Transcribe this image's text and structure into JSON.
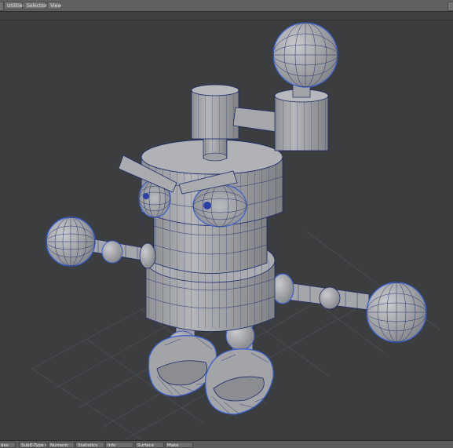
{
  "app": {
    "menu_tabs": [
      "Utilities",
      "Selection",
      "View"
    ]
  },
  "statusbar": {
    "sides_label": "des",
    "subd_label": "SubD-Type",
    "numeric_label": "Numeric",
    "statistics_label": "Statistics",
    "info_label": "Info",
    "surface_label": "Surface",
    "make_label": "Make"
  },
  "icons": {
    "dropdown": "chevron-down-icon"
  },
  "colors": {
    "viewport_bg": "#3b3d3f",
    "grid_line": "#4d5052",
    "model_fill": "#9a9c9f",
    "wire": "#1a2a6e",
    "wire_highlight": "#3a5fd0"
  }
}
